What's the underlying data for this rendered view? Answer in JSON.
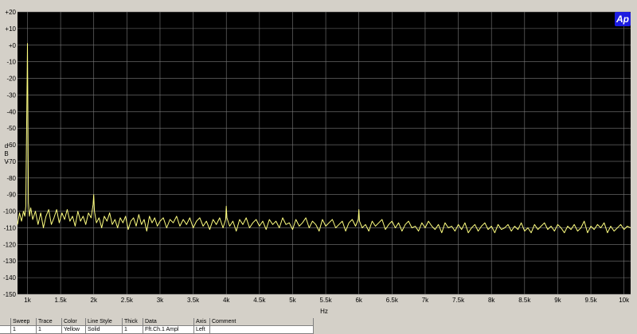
{
  "chart_data": {
    "type": "line",
    "title": "",
    "xlabel": "Hz",
    "ylabel_letters": [
      "d",
      "B",
      "V"
    ],
    "xlim": [
      850,
      10100
    ],
    "ylim": [
      -150,
      20
    ],
    "grid": true,
    "colors": {
      "background": "#000000",
      "grid": "#7a7a7a",
      "trace": "#ffff80"
    },
    "x_ticks": [
      {
        "v": 1000,
        "label": "1k"
      },
      {
        "v": 1500,
        "label": "1.5k"
      },
      {
        "v": 2000,
        "label": "2k"
      },
      {
        "v": 2500,
        "label": "2.5k"
      },
      {
        "v": 3000,
        "label": "3k"
      },
      {
        "v": 3500,
        "label": "3.5k"
      },
      {
        "v": 4000,
        "label": "4k"
      },
      {
        "v": 4500,
        "label": "4.5k"
      },
      {
        "v": 5000,
        "label": "5k"
      },
      {
        "v": 5500,
        "label": "5.5k"
      },
      {
        "v": 6000,
        "label": "6k"
      },
      {
        "v": 6500,
        "label": "6.5k"
      },
      {
        "v": 7000,
        "label": "7k"
      },
      {
        "v": 7500,
        "label": "7.5k"
      },
      {
        "v": 8000,
        "label": "8k"
      },
      {
        "v": 8500,
        "label": "8.5k"
      },
      {
        "v": 9000,
        "label": "9k"
      },
      {
        "v": 9500,
        "label": "9.5k"
      },
      {
        "v": 10000,
        "label": "10k"
      }
    ],
    "y_ticks": [
      {
        "v": 20,
        "label": "+20"
      },
      {
        "v": 10,
        "label": "+10"
      },
      {
        "v": 0,
        "label": "+0"
      },
      {
        "v": -10,
        "label": "-10"
      },
      {
        "v": -20,
        "label": "-20"
      },
      {
        "v": -30,
        "label": "-30"
      },
      {
        "v": -40,
        "label": "-40"
      },
      {
        "v": -50,
        "label": "-50"
      },
      {
        "v": -60,
        "label": "-60"
      },
      {
        "v": -70,
        "label": "-70"
      },
      {
        "v": -80,
        "label": "-80"
      },
      {
        "v": -90,
        "label": "-90"
      },
      {
        "v": -100,
        "label": "-100"
      },
      {
        "v": -110,
        "label": "-110"
      },
      {
        "v": -120,
        "label": "-120"
      },
      {
        "v": -130,
        "label": "-130"
      },
      {
        "v": -140,
        "label": "-140"
      },
      {
        "v": -150,
        "label": "-150"
      }
    ],
    "series": [
      {
        "name": "Fft.Ch.1 Ampl",
        "color": "Yellow",
        "x": [
          850,
          880,
          910,
          940,
          960,
          975,
          985,
          995,
          1000,
          1005,
          1015,
          1030,
          1050,
          1080,
          1120,
          1160,
          1200,
          1240,
          1280,
          1320,
          1360,
          1400,
          1440,
          1480,
          1520,
          1560,
          1600,
          1640,
          1680,
          1720,
          1760,
          1800,
          1840,
          1880,
          1920,
          1960,
          1990,
          2000,
          2010,
          2040,
          2080,
          2120,
          2160,
          2200,
          2240,
          2280,
          2320,
          2360,
          2400,
          2440,
          2480,
          2520,
          2560,
          2600,
          2640,
          2680,
          2720,
          2760,
          2800,
          2840,
          2880,
          2920,
          2960,
          3000,
          3050,
          3100,
          3150,
          3200,
          3250,
          3300,
          3350,
          3400,
          3450,
          3500,
          3550,
          3600,
          3650,
          3700,
          3750,
          3800,
          3850,
          3900,
          3950,
          3990,
          4000,
          4010,
          4050,
          4100,
          4150,
          4200,
          4250,
          4300,
          4350,
          4400,
          4450,
          4500,
          4550,
          4600,
          4650,
          4700,
          4750,
          4800,
          4850,
          4900,
          4950,
          5000,
          5050,
          5100,
          5150,
          5200,
          5250,
          5300,
          5350,
          5400,
          5450,
          5500,
          5550,
          5600,
          5650,
          5700,
          5750,
          5800,
          5850,
          5900,
          5950,
          5990,
          6000,
          6010,
          6050,
          6100,
          6150,
          6200,
          6250,
          6300,
          6350,
          6400,
          6450,
          6500,
          6550,
          6600,
          6650,
          6700,
          6750,
          6800,
          6850,
          6900,
          6950,
          7000,
          7050,
          7100,
          7150,
          7200,
          7250,
          7300,
          7350,
          7400,
          7450,
          7500,
          7550,
          7600,
          7650,
          7700,
          7750,
          7800,
          7850,
          7900,
          7950,
          8000,
          8050,
          8100,
          8150,
          8200,
          8250,
          8300,
          8350,
          8400,
          8450,
          8500,
          8550,
          8600,
          8650,
          8700,
          8750,
          8800,
          8850,
          8900,
          8950,
          9000,
          9050,
          9100,
          9150,
          9200,
          9250,
          9300,
          9350,
          9400,
          9450,
          9500,
          9550,
          9600,
          9650,
          9700,
          9750,
          9800,
          9850,
          9900,
          9950,
          10000,
          10050,
          10100
        ],
        "y": [
          -108,
          -101,
          -106,
          -100,
          -103,
          -97,
          -60,
          -20,
          1,
          -30,
          -95,
          -103,
          -98,
          -105,
          -100,
          -108,
          -101,
          -110,
          -103,
          -99,
          -108,
          -104,
          -99,
          -107,
          -101,
          -105,
          -99,
          -106,
          -103,
          -109,
          -100,
          -106,
          -103,
          -108,
          -101,
          -104,
          -96,
          -90,
          -100,
          -107,
          -104,
          -110,
          -103,
          -106,
          -101,
          -108,
          -105,
          -110,
          -104,
          -107,
          -103,
          -111,
          -106,
          -104,
          -109,
          -102,
          -108,
          -105,
          -112,
          -103,
          -107,
          -104,
          -109,
          -106,
          -104,
          -110,
          -105,
          -107,
          -103,
          -109,
          -105,
          -108,
          -104,
          -110,
          -106,
          -104,
          -109,
          -106,
          -111,
          -105,
          -108,
          -104,
          -110,
          -105,
          -97,
          -104,
          -109,
          -106,
          -112,
          -105,
          -108,
          -104,
          -110,
          -107,
          -105,
          -109,
          -106,
          -111,
          -105,
          -108,
          -106,
          -110,
          -104,
          -108,
          -107,
          -111,
          -105,
          -109,
          -107,
          -104,
          -110,
          -106,
          -108,
          -112,
          -105,
          -109,
          -107,
          -105,
          -110,
          -108,
          -106,
          -112,
          -107,
          -105,
          -109,
          -105,
          -99,
          -106,
          -110,
          -108,
          -112,
          -106,
          -109,
          -107,
          -105,
          -111,
          -108,
          -106,
          -110,
          -107,
          -112,
          -108,
          -106,
          -110,
          -109,
          -112,
          -107,
          -110,
          -106,
          -109,
          -111,
          -108,
          -113,
          -107,
          -110,
          -109,
          -112,
          -108,
          -111,
          -107,
          -113,
          -110,
          -108,
          -112,
          -109,
          -107,
          -111,
          -109,
          -113,
          -108,
          -111,
          -110,
          -108,
          -112,
          -109,
          -111,
          -107,
          -112,
          -110,
          -113,
          -108,
          -111,
          -109,
          -107,
          -111,
          -109,
          -112,
          -108,
          -110,
          -113,
          -109,
          -111,
          -108,
          -112,
          -110,
          -106,
          -113,
          -109,
          -111,
          -108,
          -110,
          -107,
          -113,
          -109,
          -112,
          -110,
          -108,
          -111,
          -109,
          -110
        ]
      }
    ]
  },
  "legend": {
    "headers": [
      "",
      "Sweep",
      "Trace",
      "Color",
      "Line Style",
      "Thick",
      "Data",
      "Axis",
      "Comment"
    ],
    "rows": [
      [
        "",
        "1",
        "1",
        "Yellow",
        "Solid",
        "1",
        "Fft.Ch.1 Ampl",
        "Left",
        ""
      ]
    ]
  }
}
